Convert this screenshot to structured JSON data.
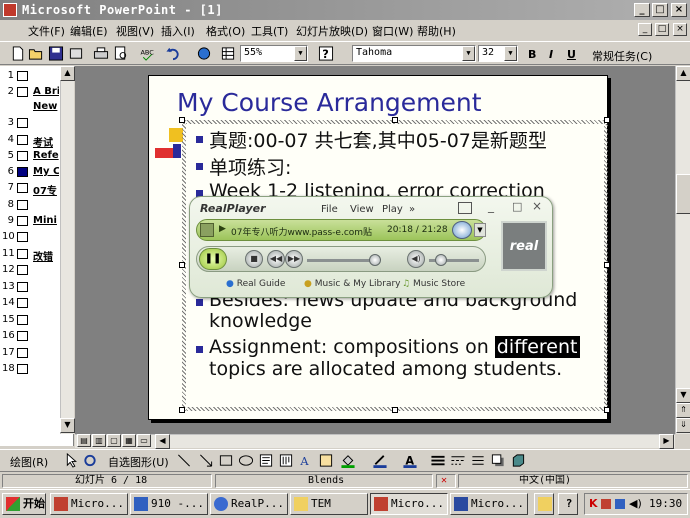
{
  "window": {
    "title": "Microsoft PowerPoint - [1]",
    "controls": [
      "_",
      "□",
      "×"
    ]
  },
  "menu": {
    "items": [
      "文件(F)",
      "编辑(E)",
      "视图(V)",
      "插入(I)",
      "格式(O)",
      "工具(T)",
      "幻灯片放映(D)",
      "窗口(W)",
      "帮助(H)"
    ]
  },
  "toolbar": {
    "zoom": "55%",
    "font": "Tahoma",
    "size": "32",
    "bold": "B",
    "italic": "I",
    "underline": "U",
    "task_label": "常规任务(C)"
  },
  "outline": {
    "items": [
      {
        "num": "1",
        "label": ""
      },
      {
        "num": "2",
        "label": "A Bri"
      },
      {
        "num": "",
        "label": "New"
      },
      {
        "num": "3",
        "label": ""
      },
      {
        "num": "4",
        "label": "考试"
      },
      {
        "num": "5",
        "label": "Refe"
      },
      {
        "num": "6",
        "label": "My C"
      },
      {
        "num": "7",
        "label": "07专"
      },
      {
        "num": "8",
        "label": ""
      },
      {
        "num": "9",
        "label": "Mini"
      },
      {
        "num": "10",
        "label": ""
      },
      {
        "num": "11",
        "label": "改错"
      },
      {
        "num": "12",
        "label": ""
      },
      {
        "num": "13",
        "label": ""
      },
      {
        "num": "14",
        "label": ""
      },
      {
        "num": "15",
        "label": ""
      },
      {
        "num": "16",
        "label": ""
      },
      {
        "num": "17",
        "label": ""
      },
      {
        "num": "18",
        "label": ""
      }
    ]
  },
  "slide": {
    "title": "My Course Arrangement",
    "bullets": [
      "真题:00-07 共七套,其中05-07是新题型",
      "单项练习:",
      "Week 1-2  listening, error correction",
      "Besides: news update and background",
      "knowledge",
      "Assignment: compositions on ",
      "different",
      "topics are allocated among students."
    ]
  },
  "realplayer": {
    "logo": "RealPlayer",
    "menu": [
      "File",
      "View",
      "Play",
      "»"
    ],
    "track": "07年专八听力www.pass-e.com贴",
    "time": "20:18 / 21:28",
    "footer": [
      "Real Guide",
      "Music & My Library",
      "Music Store"
    ],
    "brand": "real"
  },
  "drawbar": {
    "draw": "绘图(R)",
    "autoshapes": "自选图形(U)"
  },
  "status": {
    "slide": "幻灯片 6 / 18",
    "design": "Blends",
    "lang": "中文(中国)"
  },
  "taskbar": {
    "start": "开始",
    "tasks": [
      "Micro...",
      "910 -...",
      "RealP...",
      "TEM",
      "Micro...",
      "Micro..."
    ],
    "clock": "19:30"
  }
}
